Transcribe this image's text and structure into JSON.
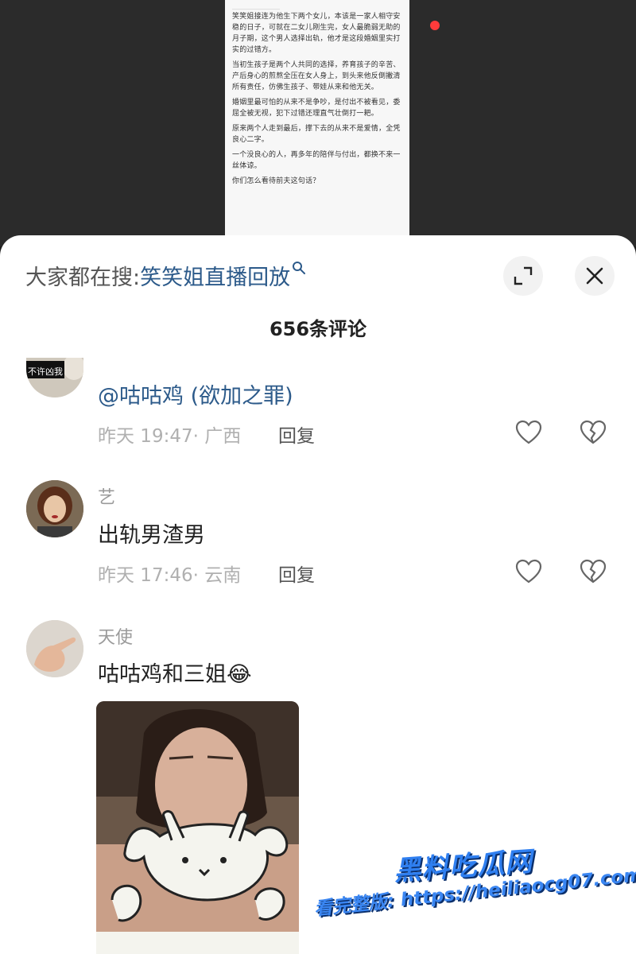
{
  "article": {
    "paragraphs": [
      "笑笑姐接连为他生下两个女儿，本该是一家人相守安稳的日子，可就在二女儿刚生完，女人最脆弱无助的月子期，这个男人选择出轨，他才是这段婚姻里实打实的过错方。",
      "当初生孩子是两个人共同的选择，养育孩子的辛苦、产后身心的煎熬全压在女人身上，到头来他反倒撇清所有责任，仿佛生孩子、带娃从来和他无关。",
      "婚姻里最可怕的从来不是争吵，是付出不被看见，委屈全被无视，犯下过错还理直气壮倒打一耙。",
      "原来两个人走到最后，撑下去的从来不是爱情，全凭良心二字。",
      "一个没良心的人，再多年的陪伴与付出，都换不来一丝体谅。",
      "你们怎么看待前夫这句话？"
    ]
  },
  "search": {
    "prefix": "大家都在搜:",
    "query": "笑笑姐直播回放"
  },
  "comments_header": {
    "title": "656条评论"
  },
  "comments": [
    {
      "avatar_text": "不许凶我",
      "content": "@咕咕鸡 (欲加之罪)",
      "meta": "昨天 19:47· 广西",
      "reply_label": "回复"
    },
    {
      "username": "艺",
      "content": "出轨男渣男",
      "meta": "昨天 17:46· 云南",
      "reply_label": "回复"
    },
    {
      "username": "天使",
      "content": "咕咕鸡和三姐😂"
    }
  ],
  "watermark": {
    "brand": "黑料吃瓜网",
    "url": "看完整版: https://heiliaocg07.com"
  },
  "colors": {
    "link": "#2c5a8a",
    "record_dot": "#ff3b3b",
    "watermark_blue": "#2f7ff0"
  },
  "icons": [
    "magnifier-icon",
    "expand-icon",
    "close-icon",
    "heart-icon",
    "broken-heart-icon"
  ]
}
